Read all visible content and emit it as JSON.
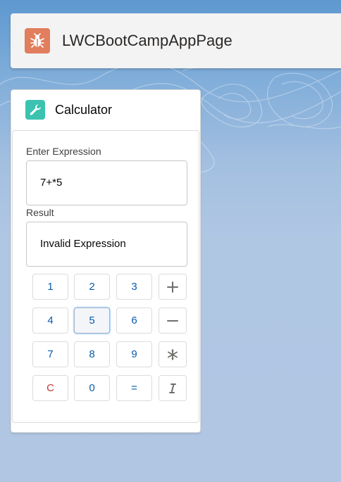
{
  "app": {
    "title": "LWCBootCampAppPage",
    "icon": "bug-icon",
    "icon_color": "#e07e5d"
  },
  "card": {
    "title": "Calculator",
    "icon": "wrench-icon",
    "icon_color": "#3bc2b0"
  },
  "expression": {
    "label": "Enter Expression",
    "value": "7+*5"
  },
  "result": {
    "label": "Result",
    "value": "Invalid Expression"
  },
  "keys": {
    "k1": "1",
    "k2": "2",
    "k3": "3",
    "k4": "4",
    "k5": "5",
    "k6": "6",
    "k7": "7",
    "k8": "8",
    "k9": "9",
    "clear": "C",
    "k0": "0",
    "equals": "="
  },
  "key_icons": {
    "add": "add-icon",
    "subtract": "minus-icon",
    "multiply": "asterisk-icon",
    "divide": "italic-icon"
  },
  "focused_key": "5"
}
